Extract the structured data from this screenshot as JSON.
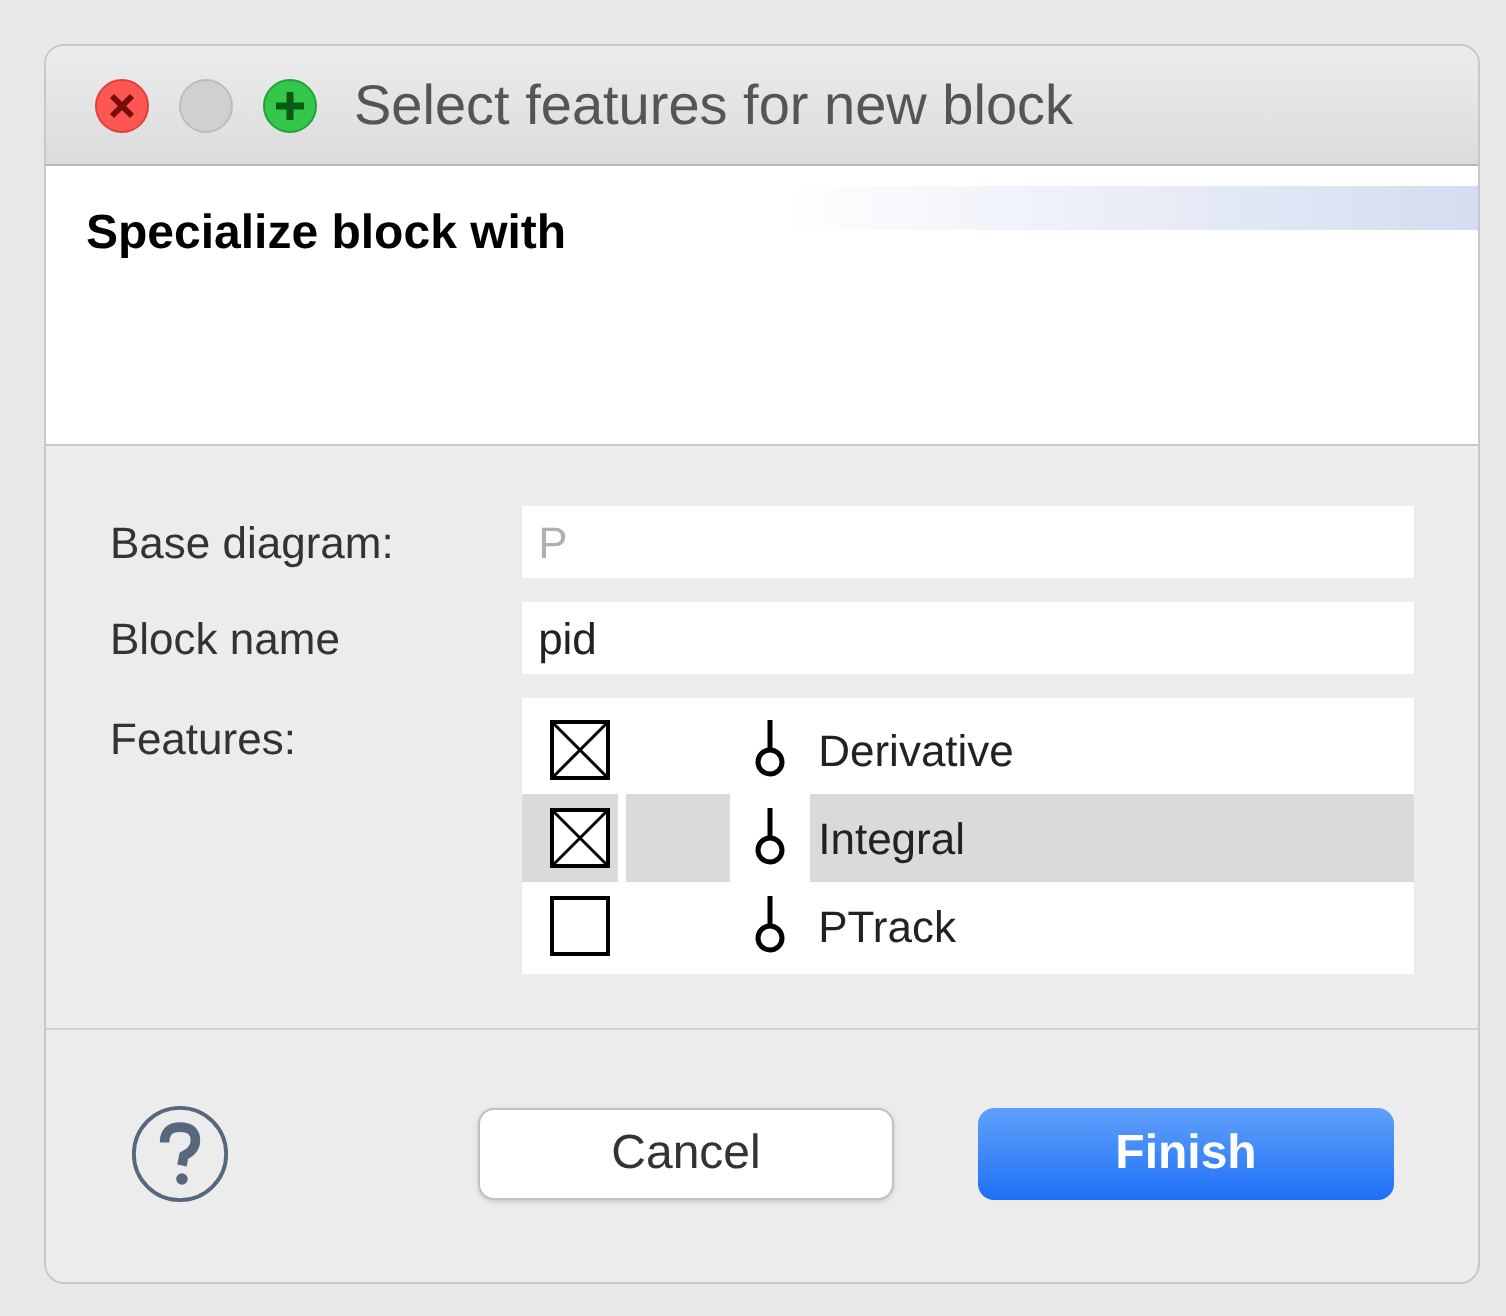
{
  "window": {
    "title": "Select features for new block"
  },
  "header": {
    "title": "Specialize block with"
  },
  "fields": [
    {
      "label": "Base diagram:",
      "value": "P",
      "disabled": true
    },
    {
      "label": "Block name",
      "value": "pid",
      "disabled": false
    }
  ],
  "features": {
    "label": "Features:",
    "items": [
      {
        "name": "Derivative",
        "checked": true,
        "selected": false
      },
      {
        "name": "Integral",
        "checked": true,
        "selected": true
      },
      {
        "name": "PTrack",
        "checked": false,
        "selected": false
      }
    ]
  },
  "buttons": [
    {
      "label": "Cancel",
      "kind": "secondary"
    },
    {
      "label": "Finish",
      "kind": "primary"
    }
  ]
}
